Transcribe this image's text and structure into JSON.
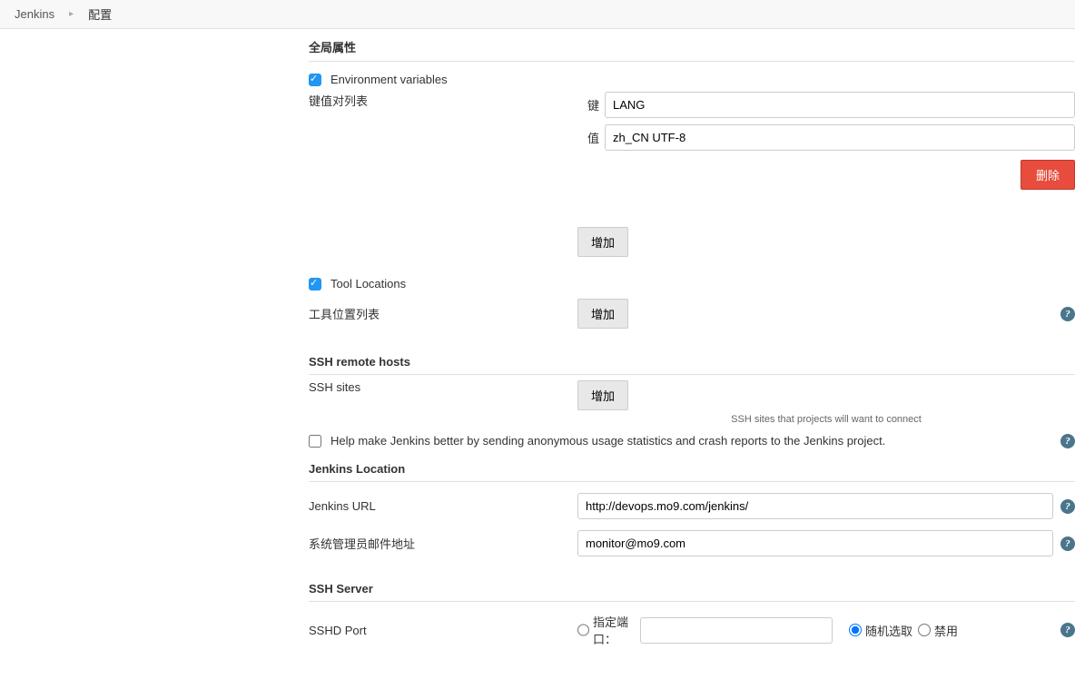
{
  "breadcrumb": {
    "root": "Jenkins",
    "current": "配置"
  },
  "sections": {
    "global_props": "全局属性",
    "ssh_remote": "SSH remote hosts",
    "jenkins_loc": "Jenkins Location",
    "ssh_server": "SSH Server"
  },
  "env": {
    "checkbox_label": "Environment variables",
    "list_label": "键值对列表",
    "key_label": "键",
    "key_value": "LANG",
    "val_label": "值",
    "val_value": "zh_CN UTF-8",
    "delete_btn": "删除",
    "add_btn": "增加"
  },
  "tool": {
    "checkbox_label": "Tool Locations",
    "list_label": "工具位置列表",
    "add_btn": "增加"
  },
  "ssh_sites": {
    "label": "SSH sites",
    "add_btn": "增加",
    "hint": "SSH sites that projects will want to connect"
  },
  "stats": {
    "label": "Help make Jenkins better by sending anonymous usage statistics and crash reports to the Jenkins project."
  },
  "loc": {
    "url_label": "Jenkins URL",
    "url_value": "http://devops.mo9.com/jenkins/",
    "admin_label": "系统管理员邮件地址",
    "admin_value": "monitor@mo9.com"
  },
  "sshd": {
    "port_label": "SSHD Port",
    "opt_fixed": "指定端口：",
    "opt_random": "随机选取",
    "opt_disable": "禁用"
  }
}
